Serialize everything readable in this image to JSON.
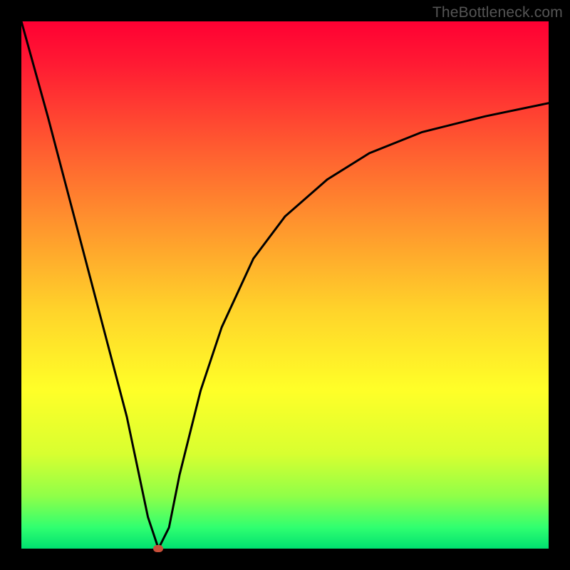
{
  "watermark": "TheBottleneck.com",
  "chart_data": {
    "type": "line",
    "title": "",
    "xlabel": "",
    "ylabel": "",
    "xlim": [
      0,
      100
    ],
    "ylim": [
      0,
      100
    ],
    "background": "rainbow-gradient-vertical",
    "series": [
      {
        "name": "bottleneck-curve",
        "x": [
          0,
          5,
          10,
          15,
          20,
          24,
          26,
          28,
          30,
          34,
          38,
          44,
          50,
          58,
          66,
          76,
          88,
          100
        ],
        "y": [
          100,
          82,
          63,
          44,
          25,
          6,
          0,
          4,
          14,
          30,
          42,
          55,
          63,
          70,
          75,
          79,
          82,
          84.5
        ]
      }
    ],
    "marker": {
      "name": "optimum-dot",
      "x": 26,
      "y": 0,
      "color": "#c94f3a"
    }
  }
}
